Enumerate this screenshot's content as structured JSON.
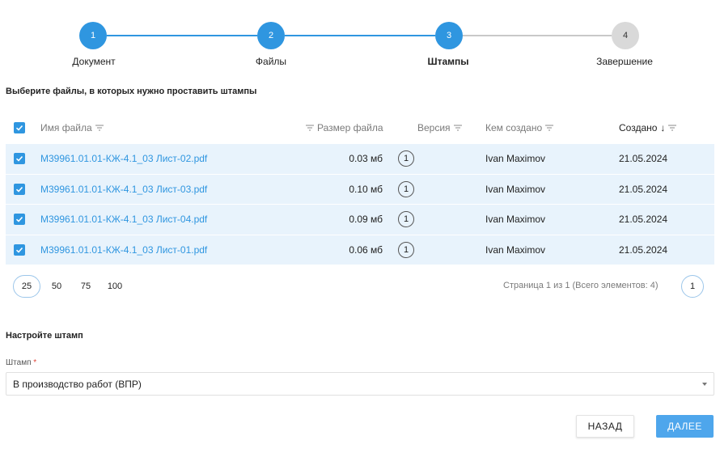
{
  "stepper": {
    "steps": [
      {
        "number": "1",
        "label": "Документ",
        "state": "done"
      },
      {
        "number": "2",
        "label": "Файлы",
        "state": "done"
      },
      {
        "number": "3",
        "label": "Штампы",
        "state": "active"
      },
      {
        "number": "4",
        "label": "Завершение",
        "state": "todo"
      }
    ]
  },
  "files_section": {
    "title": "Выберите файлы, в которых нужно проставить штампы"
  },
  "table": {
    "columns": {
      "name": "Имя файла",
      "size": "Размер файла",
      "version": "Версия",
      "created_by": "Кем создано",
      "created": "Создано"
    },
    "sort_arrow": "↓",
    "rows": [
      {
        "name": "M39961.01.01-КЖ-4.1_03 Лист-02.pdf",
        "size": "0.03 мб",
        "version": "1",
        "created_by": "Ivan Maximov",
        "created": "21.05.2024"
      },
      {
        "name": "M39961.01.01-КЖ-4.1_03 Лист-03.pdf",
        "size": "0.10 мб",
        "version": "1",
        "created_by": "Ivan Maximov",
        "created": "21.05.2024"
      },
      {
        "name": "M39961.01.01-КЖ-4.1_03 Лист-04.pdf",
        "size": "0.09 мб",
        "version": "1",
        "created_by": "Ivan Maximov",
        "created": "21.05.2024"
      },
      {
        "name": "M39961.01.01-КЖ-4.1_03 Лист-01.pdf",
        "size": "0.06 мб",
        "version": "1",
        "created_by": "Ivan Maximov",
        "created": "21.05.2024"
      }
    ]
  },
  "pagination": {
    "page_sizes": [
      "25",
      "50",
      "75",
      "100"
    ],
    "selected_page_size": "25",
    "info": "Страница 1 из 1 (Всего элементов: 4)",
    "current_page": "1"
  },
  "stamp_section": {
    "title": "Настройте штамп",
    "field_label": "Штамп",
    "required_mark": "*",
    "selected_value": "В производство работ (ВПР)"
  },
  "buttons": {
    "back": "НАЗАД",
    "next": "ДАЛЕЕ"
  },
  "colors": {
    "accent": "#2f96e0",
    "row_highlight": "#e8f3fc",
    "next_button": "#4ea6ec"
  }
}
